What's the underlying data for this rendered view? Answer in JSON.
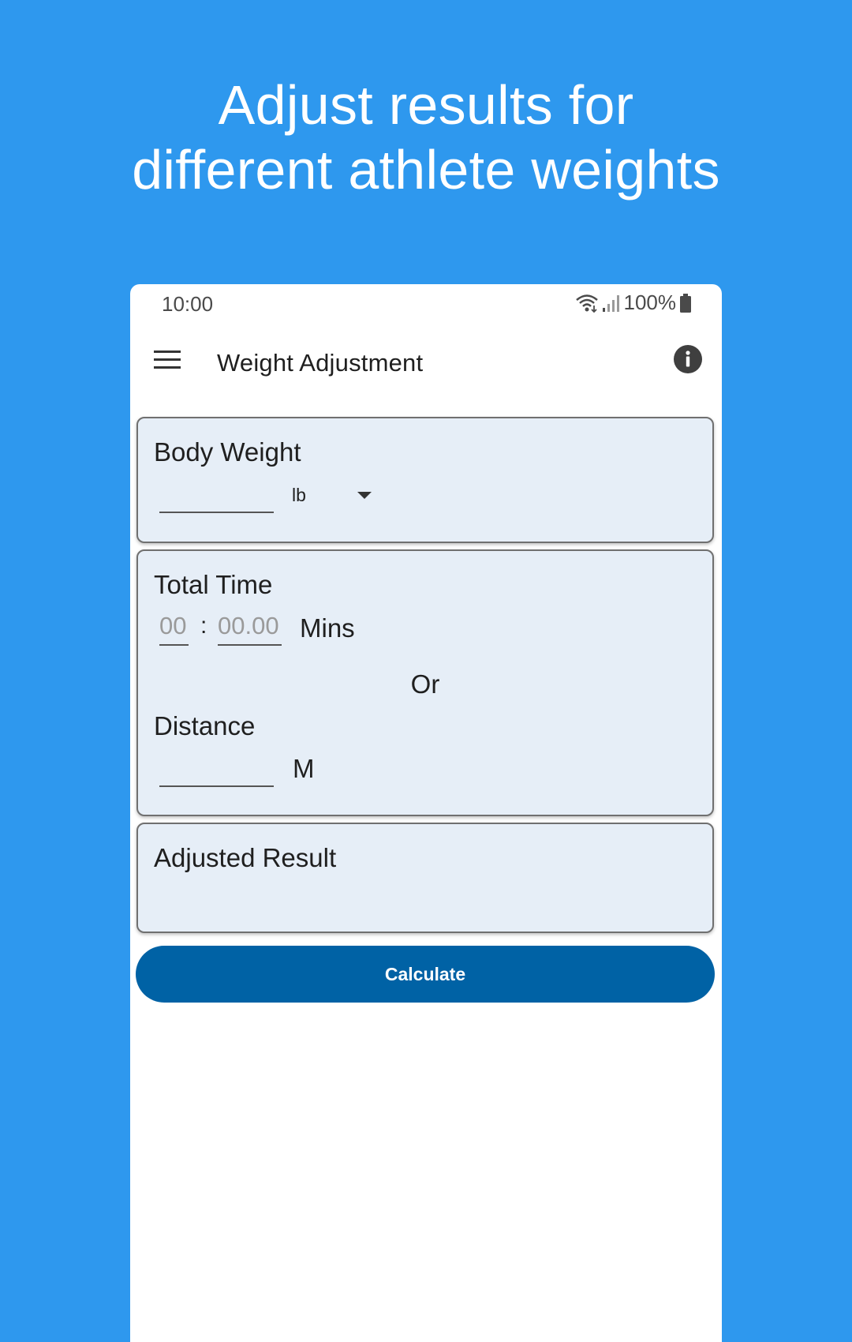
{
  "headline": {
    "line1": "Adjust results for",
    "line2": "different athlete weights"
  },
  "status_bar": {
    "time": "10:00",
    "battery": "100%",
    "icons": [
      "wifi-icon",
      "signal-icon",
      "battery-icon"
    ]
  },
  "app_bar": {
    "title": "Weight Adjustment",
    "menu_icon": "menu-icon",
    "info_icon": "info-icon"
  },
  "body_weight": {
    "label": "Body Weight",
    "value": "",
    "unit_selected": "lb",
    "dropdown_icon": "dropdown-arrow-icon"
  },
  "time_distance": {
    "total_time_label": "Total Time",
    "minutes_placeholder": "00",
    "separator": ":",
    "seconds_placeholder": "00.00",
    "time_unit": "Mins",
    "or_label": "Or",
    "distance_label": "Distance",
    "distance_value": "",
    "distance_unit": "M"
  },
  "result": {
    "label": "Adjusted Result",
    "value": ""
  },
  "actions": {
    "calculate_label": "Calculate"
  },
  "colors": {
    "background": "#2e98ee",
    "card": "#e6eef7",
    "button": "#0062a5",
    "text": "#1f1f1f"
  }
}
